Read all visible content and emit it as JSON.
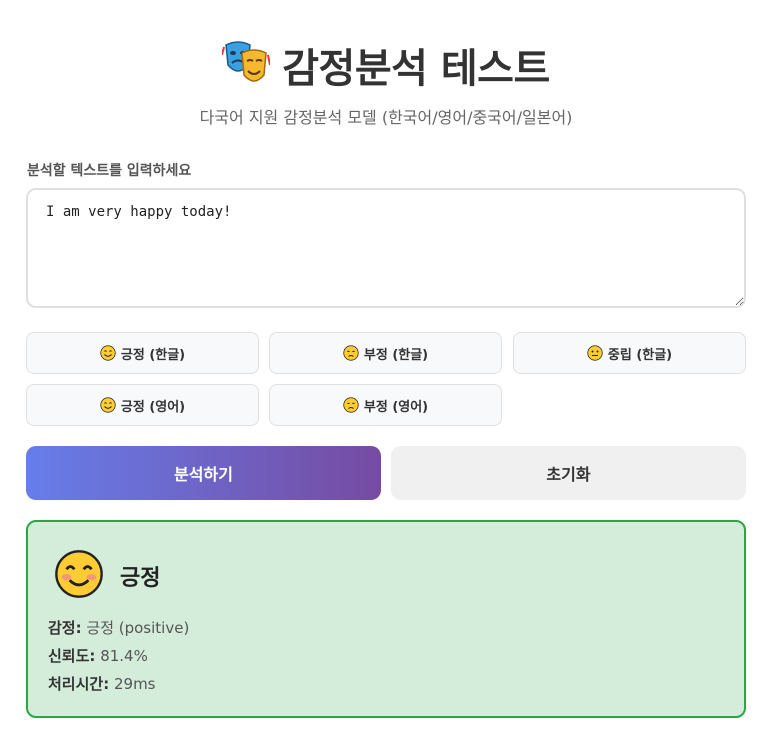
{
  "header": {
    "title": "감정분석 테스트",
    "title_icon": "theater-masks-icon",
    "subtitle": "다국어 지원 감정분석 모델 (한국어/영어/중국어/일본어)"
  },
  "input": {
    "label": "분석할 텍스트를 입력하세요",
    "value": "I am very happy today!"
  },
  "samples": [
    {
      "label": "긍정 (한글)",
      "icon": "smiling-face-icon"
    },
    {
      "label": "부정 (한글)",
      "icon": "sad-face-icon"
    },
    {
      "label": "중립 (한글)",
      "icon": "neutral-face-icon"
    },
    {
      "label": "긍정 (영어)",
      "icon": "smiling-face-icon"
    },
    {
      "label": "부정 (영어)",
      "icon": "sad-face-icon"
    }
  ],
  "actions": {
    "analyze_label": "분석하기",
    "reset_label": "초기화"
  },
  "result": {
    "icon": "smiling-face-icon",
    "title": "긍정",
    "sentiment_label": "감정:",
    "sentiment_value": "긍정 (positive)",
    "confidence_label": "신뢰도:",
    "confidence_value": "81.4%",
    "time_label": "처리시간:",
    "time_value": "29ms"
  },
  "colors": {
    "accent_gradient_start": "#667eea",
    "accent_gradient_end": "#764ba2",
    "positive_border": "#28a745",
    "positive_background": "#d4edda"
  }
}
